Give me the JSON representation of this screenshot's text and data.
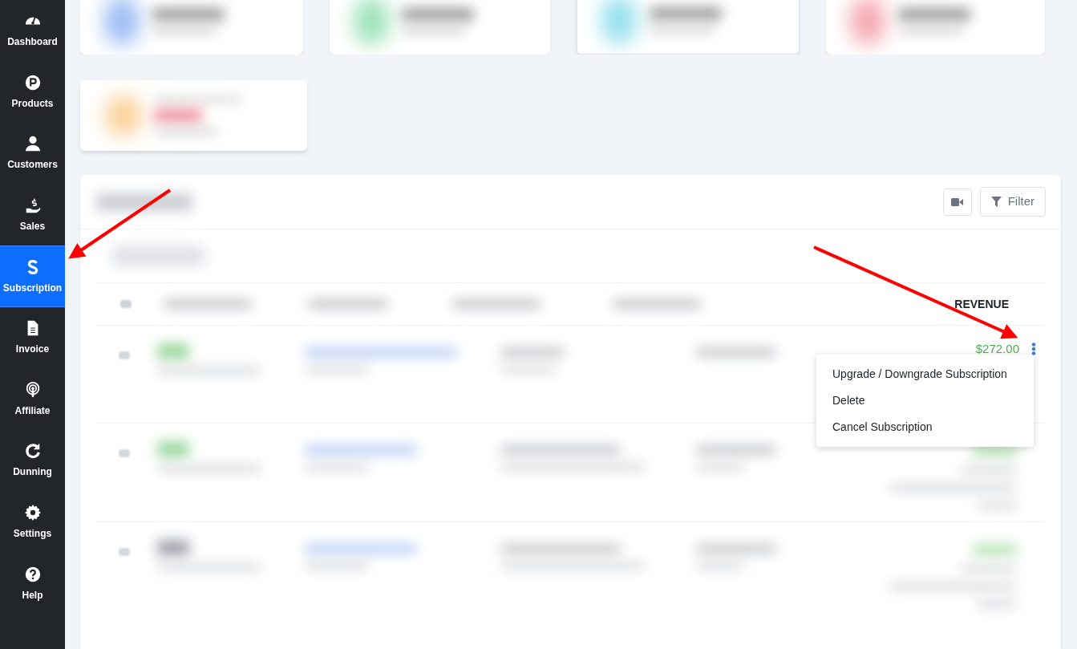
{
  "sidebar": {
    "items": [
      {
        "label": "Dashboard",
        "selected": false
      },
      {
        "label": "Products",
        "selected": false
      },
      {
        "label": "Customers",
        "selected": false
      },
      {
        "label": "Sales",
        "selected": false
      },
      {
        "label": "Subscription",
        "selected": true
      },
      {
        "label": "Invoice",
        "selected": false
      },
      {
        "label": "Affiliate",
        "selected": false
      },
      {
        "label": "Dunning",
        "selected": false
      },
      {
        "label": "Settings",
        "selected": false
      },
      {
        "label": "Help",
        "selected": false
      }
    ]
  },
  "toolbar": {
    "buttons": [
      {
        "kind": "video"
      },
      {
        "kind": "filter",
        "label": "Filter"
      }
    ]
  },
  "table": {
    "columns": [
      {
        "label": "REVENUE"
      }
    ],
    "rows": [
      {
        "revenue": "$272.00",
        "menu_open": true
      }
    ]
  },
  "row_menu": {
    "items": [
      "Upgrade / Downgrade Subscription",
      "Delete",
      "Cancel Subscription"
    ]
  }
}
